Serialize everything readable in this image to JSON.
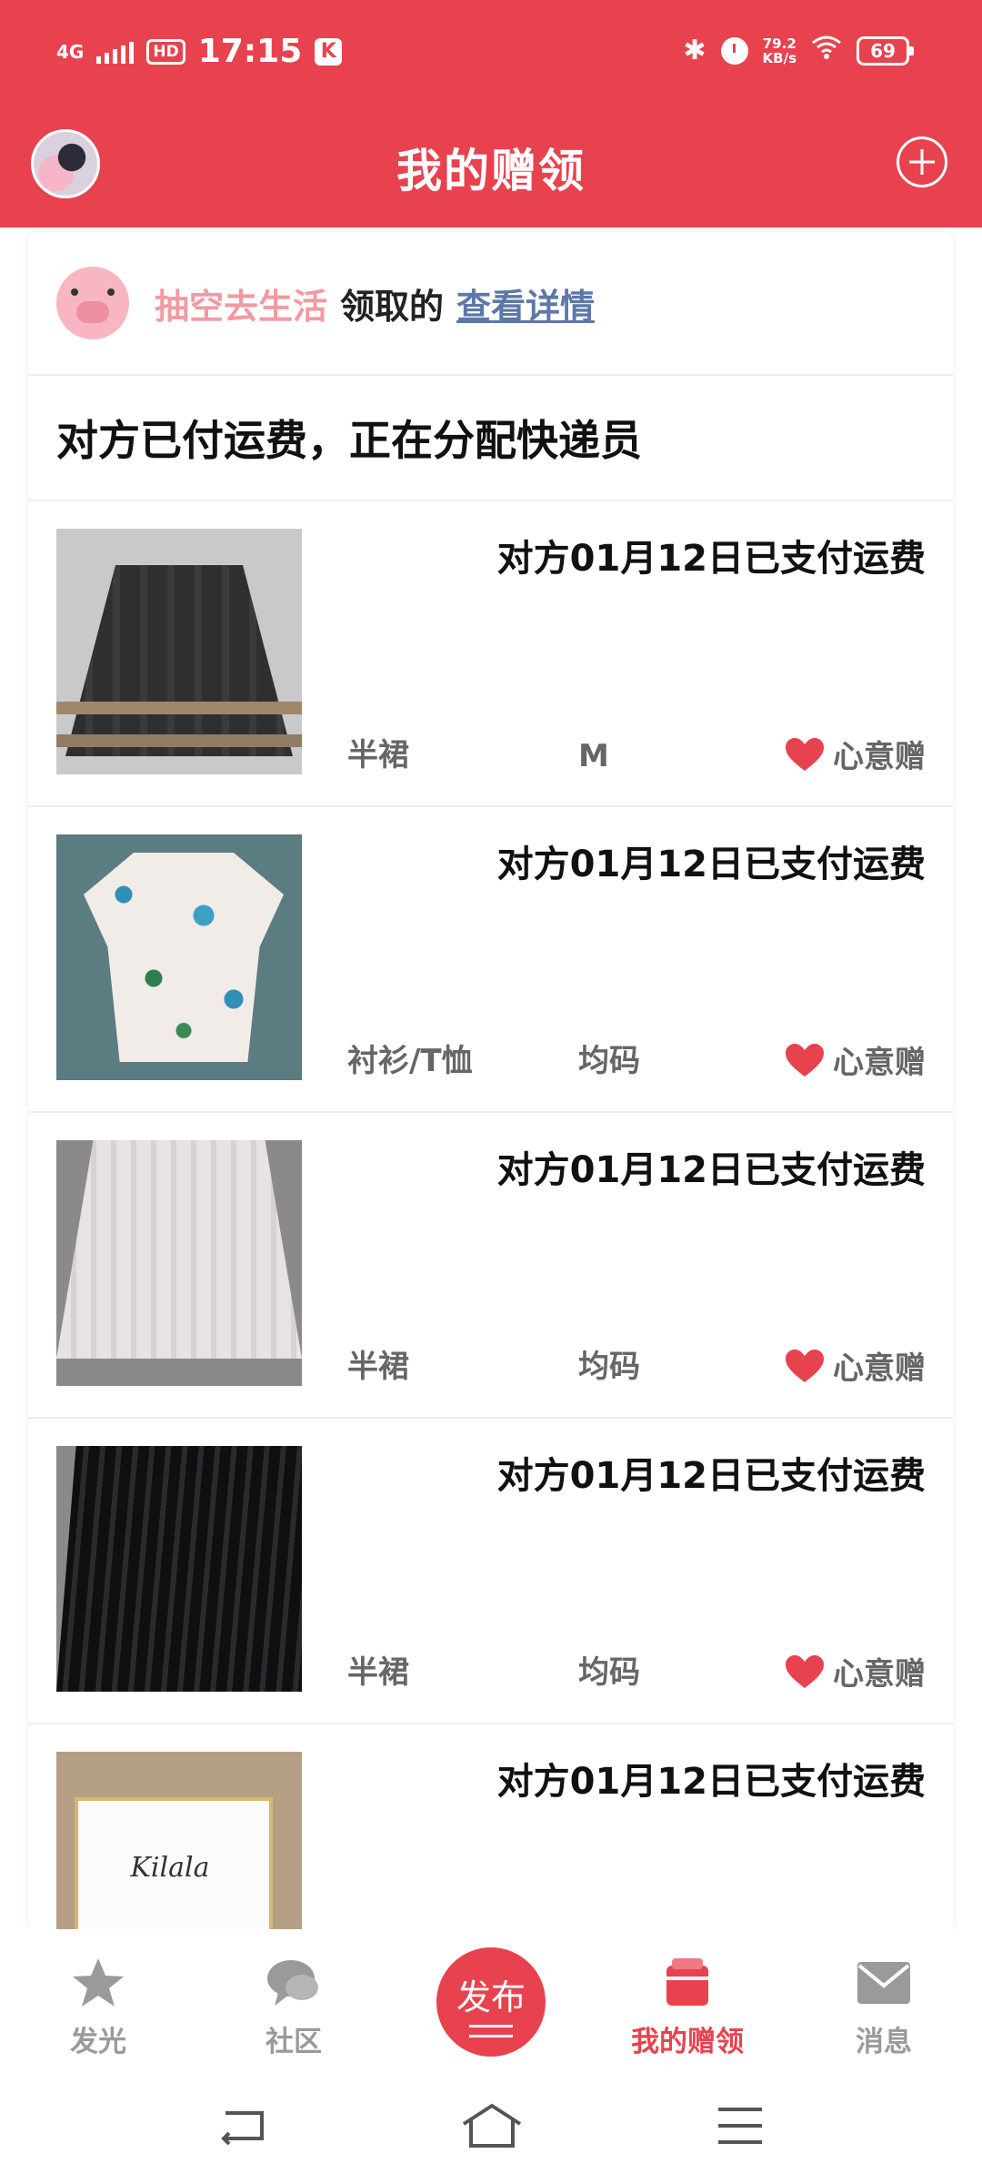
{
  "status_bar": {
    "network": "4G",
    "hd": "HD",
    "time": "17:15",
    "k_badge": "K",
    "speed_value": "79.2",
    "speed_unit": "KB/s",
    "battery": "69"
  },
  "header": {
    "title": "我的赠领"
  },
  "claim_info": {
    "owner": "抽空去生活",
    "verb": "领取的",
    "details_link": "查看详情"
  },
  "shipping_status": "对方已付运费，正在分配快递员",
  "items": [
    {
      "paid_text": "对方01月12日已支付运费",
      "category": "半裙",
      "size": "M",
      "gift_type": "心意赠"
    },
    {
      "paid_text": "对方01月12日已支付运费",
      "category": "衬衫/T恤",
      "size": "均码",
      "gift_type": "心意赠"
    },
    {
      "paid_text": "对方01月12日已支付运费",
      "category": "半裙",
      "size": "均码",
      "gift_type": "心意赠"
    },
    {
      "paid_text": "对方01月12日已支付运费",
      "category": "半裙",
      "size": "均码",
      "gift_type": "心意赠"
    },
    {
      "paid_text": "对方01月12日已支付运费",
      "brand_text": "Kilala"
    }
  ],
  "bottom_nav": {
    "shine": "发光",
    "community": "社区",
    "publish": "发布",
    "my_gifts": "我的赠领",
    "messages": "消息"
  },
  "colors": {
    "brand": "#e8424f",
    "link": "#5d78a8",
    "owner": "#f19aa3"
  },
  "icons": [
    "avatar",
    "add-icon",
    "pig-icon",
    "heart-icon",
    "star-icon",
    "chat-icon",
    "box-icon",
    "mail-icon",
    "back-icon",
    "home-icon",
    "menu-icon"
  ]
}
